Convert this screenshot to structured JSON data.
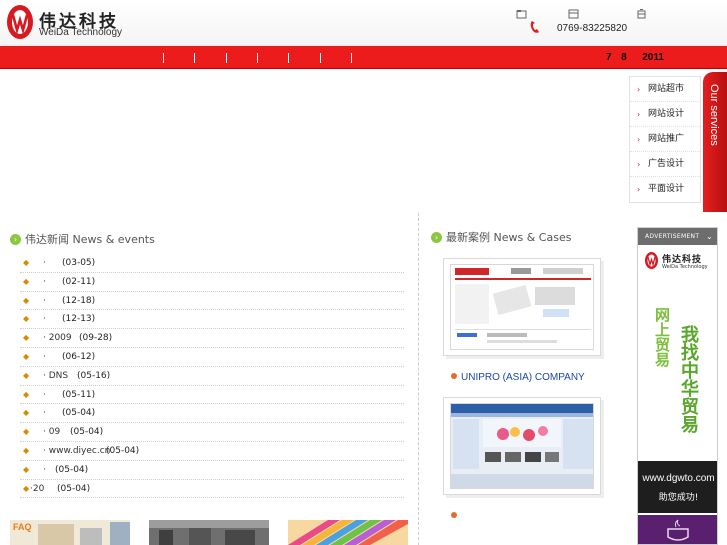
{
  "header": {
    "logo_cn": "伟达科技",
    "logo_en": "WeiDa Technology",
    "phone": "0769-83225820"
  },
  "navbar": {
    "date": {
      "month": "7",
      "day": "8",
      "year": "2011"
    }
  },
  "services": {
    "items": [
      "网站超市",
      "网站设计",
      "网站推广",
      "广告设计",
      "平面设计"
    ],
    "tab_label": "Our services"
  },
  "news": {
    "heading": "伟达新闻 News & events",
    "items": [
      {
        "title": "·",
        "date": "(03-05)"
      },
      {
        "title": "·",
        "date": "(02-11)"
      },
      {
        "title": "·",
        "date": "(12-18)"
      },
      {
        "title": "·",
        "date": "(12-13)"
      },
      {
        "title": "·   2009",
        "date": "(09-28)"
      },
      {
        "title": "·",
        "date": "(06-12)"
      },
      {
        "title": "·      DNS",
        "date": "(05-16)"
      },
      {
        "title": "·",
        "date": "(05-11)"
      },
      {
        "title": "·",
        "date": "(05-04)"
      },
      {
        "title": "·        09",
        "date": "(05-04)"
      },
      {
        "title": "·   www.diyec.cn",
        "date": "(05-04)"
      },
      {
        "title": "·",
        "date": "(05-04)"
      },
      {
        "title": "·20",
        "date": "(05-04)"
      }
    ],
    "bottom_label": "FAQ"
  },
  "cases": {
    "heading": "最新案例 News & Cases",
    "items": [
      {
        "caption": "UNIPRO (ASIA) COMPANY"
      },
      {
        "caption": ""
      }
    ]
  },
  "ad": {
    "header": "ADVERTISEMENT",
    "logo_cn": "伟达科技",
    "logo_en": "WeiDa Technology",
    "line1": "网上贸易",
    "line2": "我找中华贸易",
    "url": "www.dgwto.com",
    "slogan": "助您成功!"
  },
  "colors": {
    "brand_red": "#ec1c1c",
    "link_blue": "#1c46a8",
    "ad_green": "#5aa62a"
  }
}
